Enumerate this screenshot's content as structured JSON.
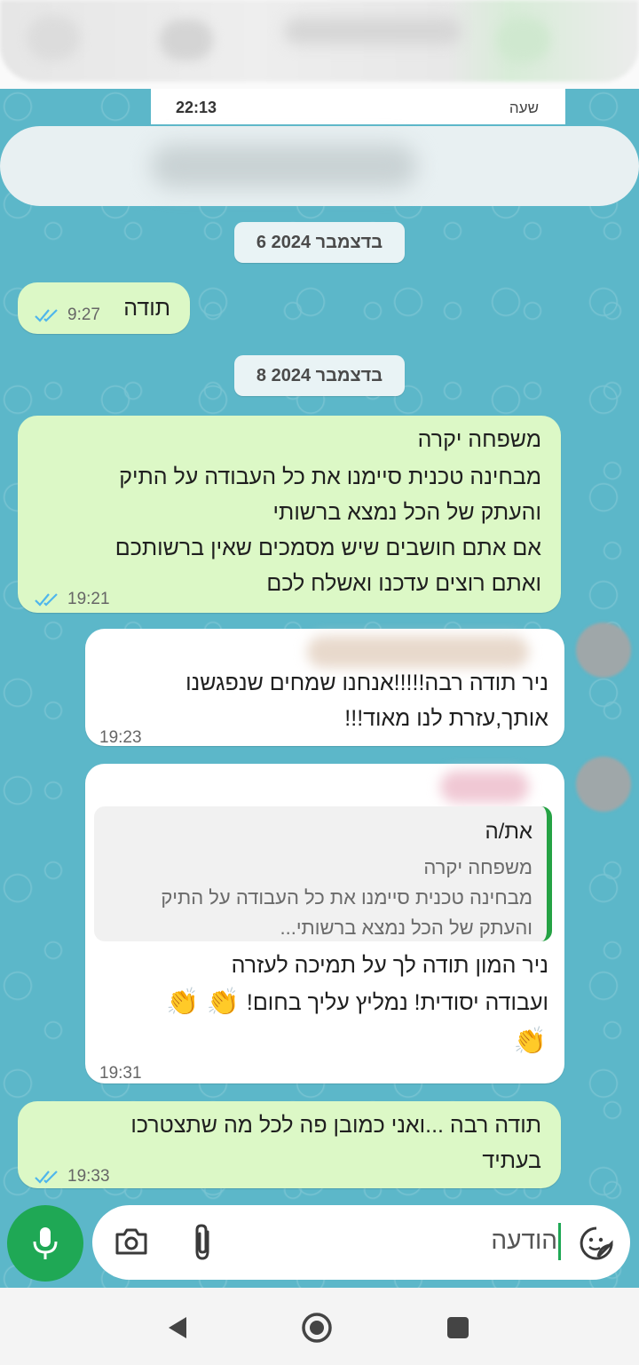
{
  "status": {
    "time": "22:13",
    "time_label": "שעה"
  },
  "dates": {
    "d1": "6 בדצמבר 2024",
    "d2": "8 בדצמבר 2024"
  },
  "messages": {
    "m1": {
      "text": "תודה",
      "time": "9:27"
    },
    "m2": {
      "lines": [
        "משפחה יקרה",
        "מבחינה טכנית סיימנו את כל העבודה על התיק",
        "והעתק של הכל נמצא ברשותי",
        "אם אתם חושבים שיש מסמכים שאין ברשותכם",
        "ואתם רוצים עדכנו ואשלח לכם"
      ],
      "time": "19:21"
    },
    "m3": {
      "lines": [
        "ניר תודה רבה!!!!!אנחנו שמחים שנפגשנו",
        "אותך,עזרת לנו מאוד!!!"
      ],
      "time": "19:23"
    },
    "m4": {
      "quote_name": "את/ה",
      "quote_lines": [
        "משפחה יקרה",
        "מבחינה טכנית סיימנו את כל העבודה על התיק",
        "והעתק של הכל נמצא ברשותי..."
      ],
      "lines": [
        "ניר המון תודה לך על תמיכה לעזרה",
        "ועבודה יסודית! נמליץ עליך בחום!"
      ],
      "emoji": "👏",
      "time": "19:31"
    },
    "m5": {
      "lines": [
        "תודה רבה ...ואני כמובן פה לכל מה שתצטרכו",
        "בעתיד"
      ],
      "time": "19:33"
    }
  },
  "composer": {
    "placeholder": "הודעה"
  },
  "icons": {
    "mic": "microphone-icon",
    "camera": "camera-icon",
    "attach": "paperclip-icon",
    "sticker": "sticker-icon",
    "ticks": "read-receipt-icon",
    "back": "back-icon",
    "home": "home-icon",
    "recents": "recents-icon"
  },
  "colors": {
    "chat_bg": "#5cb7c9",
    "outgoing": "#dcf8c6",
    "incoming": "#ffffff",
    "accent": "#1fa855",
    "ticks": "#4fb6ec"
  }
}
